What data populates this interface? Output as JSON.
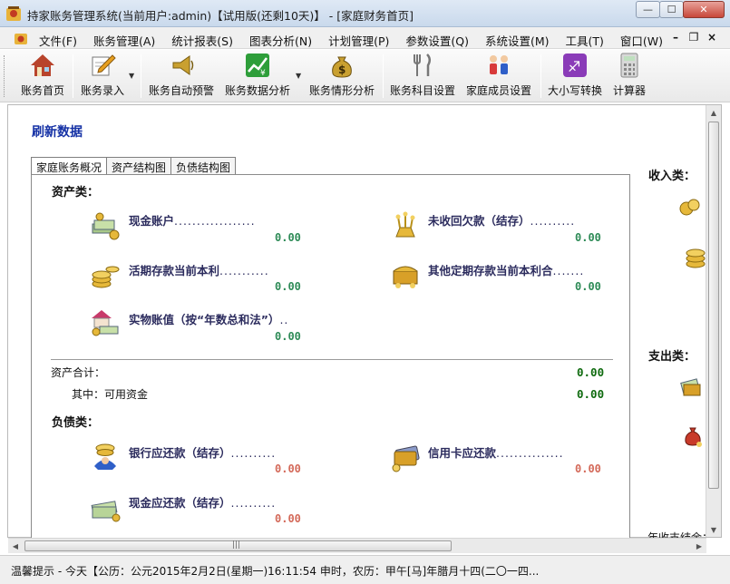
{
  "window": {
    "title": "持家账务管理系统(当前用户:admin)【试用版(还剩10天)】 - [家庭财务首页]",
    "minimize": "—",
    "maximize": "☐",
    "close": "✕"
  },
  "menu": {
    "items": [
      "文件(F)",
      "账务管理(A)",
      "统计报表(S)",
      "图表分析(N)",
      "计划管理(P)",
      "参数设置(Q)",
      "系统设置(M)",
      "工具(T)",
      "窗口(W)"
    ],
    "mdi_minimize": "–",
    "mdi_restore": "❐",
    "mdi_close": "×"
  },
  "toolbar": {
    "buttons": [
      {
        "label": "账务首页",
        "icon": "house-icon"
      },
      {
        "label": "账务录入",
        "icon": "pencil-icon"
      },
      {
        "label": "账务自动预警",
        "icon": "horn-icon"
      },
      {
        "label": "账务数据分析",
        "icon": "chart-icon"
      },
      {
        "label": "账务情形分析",
        "icon": "money-bag-icon"
      },
      {
        "label": "账务科目设置",
        "icon": "fork-knife-icon"
      },
      {
        "label": "家庭成员设置",
        "icon": "family-icon"
      },
      {
        "label": "大小写转换",
        "icon": "case-convert-icon"
      },
      {
        "label": "计算器",
        "icon": "calculator-icon"
      }
    ]
  },
  "main": {
    "refresh": "刷新数据",
    "tabs": [
      "家庭账务概况",
      "资产结构图",
      "负债结构图"
    ],
    "assets": {
      "heading": "资产类：",
      "items": [
        {
          "name": "现金账户",
          "dots": "..................",
          "value": "0.00"
        },
        {
          "name": "未收回欠款（结存）",
          "dots": "..........",
          "value": "0.00"
        },
        {
          "name": "活期存款当前本利",
          "dots": "...........",
          "value": "0.00"
        },
        {
          "name": "其他定期存款当前本利合",
          "dots": ".......",
          "value": "0.00"
        },
        {
          "name": "实物账值（按“年数总和法”）",
          "dots": "..",
          "value": "0.00"
        }
      ],
      "total_label": "资产合计：",
      "total_value": "0.00",
      "available_label": "其中：可用资金",
      "available_value": "0.00"
    },
    "liabilities": {
      "heading": "负债类：",
      "items": [
        {
          "name": "银行应还款（结存）",
          "dots": "..........",
          "value": "0.00"
        },
        {
          "name": "信用卡应还款",
          "dots": "...............",
          "value": "0.00"
        },
        {
          "name": "现金应还款（结存）",
          "dots": "..........",
          "value": "0.00"
        }
      ]
    },
    "right": {
      "income_heading": "收入类：",
      "expense_heading": "支出类：",
      "partial_label": "年收支结余："
    }
  },
  "statusbar": {
    "text": "温馨提示 - 今天【公历：公元2015年2月2日(星期一)16:11:54 申时，农历：甲午[马]年腊月十四(二〇一四..."
  },
  "colors": {
    "value_green": "#2e8b57",
    "value_red": "#d46a5a",
    "refresh_link": "#1531a5"
  }
}
